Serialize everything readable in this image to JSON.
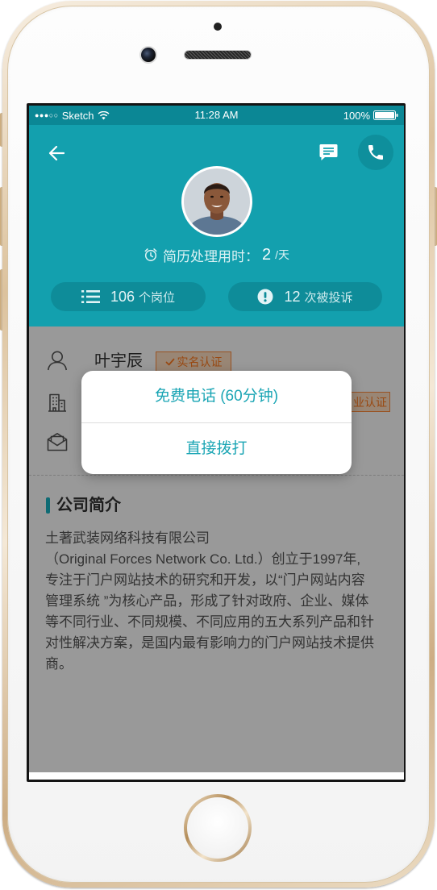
{
  "status_bar": {
    "signal": "●●●○○",
    "carrier": "Sketch",
    "time": "11:28 AM",
    "battery": "100%"
  },
  "header": {
    "resume_time": {
      "label": "简历处理用时：",
      "value": "2",
      "unit": "/天"
    },
    "stats": [
      {
        "count": "106",
        "label": "个岗位"
      },
      {
        "count": "12",
        "label": "次被投诉"
      }
    ]
  },
  "profile": {
    "name": "叶宇辰",
    "name_badge": "实名认证",
    "company_badge": "业认证"
  },
  "company_intro": {
    "title": "公司简介",
    "lines": [
      "土著武装网络科技有限公司",
      "（Original Forces Network Co. Ltd.）创立于1997年,",
      "专注于门户网站技术的研究和开发，以“门户网站内容",
      "管理系统 ”为核心产品，形成了针对政府、企业、媒体",
      "等不同行业、不同规模、不同应用的五大系列产品和针",
      "对性解决方案，是国内最有影响力的门户网站技术提供",
      "商。"
    ]
  },
  "call_sheet": {
    "options": [
      "免费电话 (60分钟)",
      "直接拨打"
    ]
  },
  "icons": {
    "back": "back-arrow-icon",
    "message": "message-icon",
    "call": "phone-icon",
    "resume_time": "alarm-clock-icon",
    "jobs": "list-icon",
    "complaints": "alert-icon",
    "name_row": "person-icon",
    "company_row": "building-icon",
    "email_row": "envelope-icon",
    "badge_check": "check-icon",
    "wifi": "wifi-icon",
    "battery": "battery-icon"
  },
  "colors": {
    "status_bar": "#0b8795",
    "header": "#13a0ae",
    "stat_pill": "#0e8c99",
    "accent_text": "#1aa5b4",
    "badge": "#ff7a1f",
    "overlay": "rgba(0,0,0,0.4)"
  }
}
